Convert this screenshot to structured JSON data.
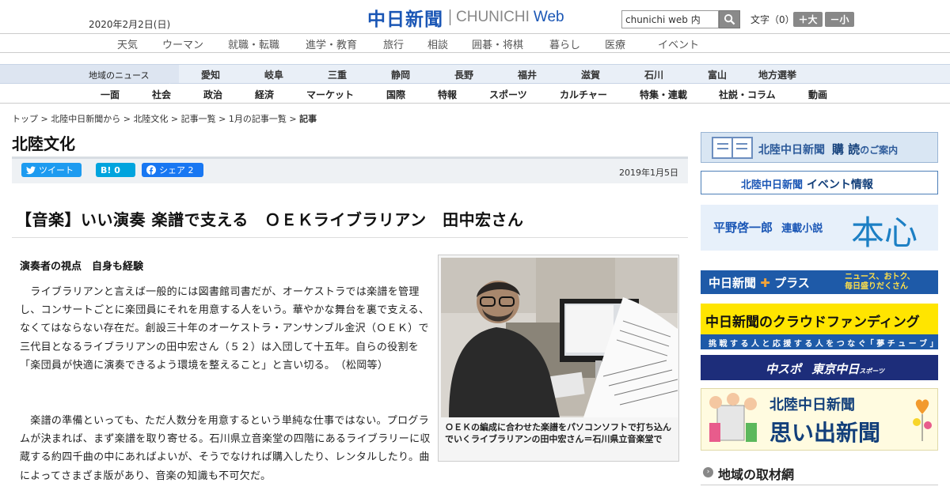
{
  "header": {
    "date": "2020年2月2日(日)",
    "logo_jp": "中日新聞",
    "logo_en": "CHUNICHI",
    "logo_web": "Web",
    "search_placeholder": "chunichi web 内",
    "font_size_label": "文字（0）",
    "font_up": "＋大",
    "font_down": "－小"
  },
  "nav_top": [
    "天気",
    "ウーマン",
    "就職・転職",
    "進学・教育",
    "旅行",
    "相談",
    "囲碁・将棋",
    "暮らし",
    "医療",
    "イベント"
  ],
  "nav_region": {
    "label": "地域のニュース",
    "items": [
      "愛知",
      "岐阜",
      "三重",
      "静岡",
      "長野",
      "福井",
      "滋賀",
      "石川",
      "富山",
      "地方選挙"
    ]
  },
  "nav_sections": [
    "一面",
    "社会",
    "政治",
    "経済",
    "マーケット",
    "国際",
    "特報",
    "スポーツ",
    "カルチャー",
    "特集・連載",
    "社説・コラム",
    "動画"
  ],
  "breadcrumb": [
    "トップ",
    "北陸中日新聞から",
    "北陸文化",
    "記事一覧",
    "1月の記事一覧",
    "記事"
  ],
  "section_title": "北陸文化",
  "share": {
    "tweet": "ツイート",
    "hatena": "B! 0",
    "facebook": "シェア 2"
  },
  "pub_date": "2019年1月5日",
  "article": {
    "headline": "【音楽】いい演奏 楽譜で支える　ＯＥＫライブラリアン　田中宏さん",
    "subhead": "演奏者の視点　自身も経験",
    "paragraphs": [
      "　ライブラリアンと言えば一般的には図書館司書だが、オーケストラでは楽譜を管理し、コンサートごとに楽団員にそれを用意する人をいう。華やかな舞台を裏で支える、なくてはならない存在だ。創設三十年のオーケストラ・アンサンブル金沢（ＯＥＫ）で三代目となるライブラリアンの田中宏さん（５２）は入団して十五年。自らの役割を「楽団員が快適に演奏できるよう環境を整えること」と言い切る。　（松岡等）",
      "　楽譜の準備といっても、ただ人数分を用意するという単純な仕事ではない。プログラムが決まれば、まず楽譜を取り寄せる。石川県立音楽堂の四階にあるライブラリーに収蔵する約四千曲の中にあればよいが、そうでなければ購入したり、レンタルしたり。曲によってさまざま版があり、音楽の知識も不可欠だ。"
    ],
    "photo_caption": "ＯＥＫの編成に合わせた楽譜をパソコンソフトで打ち込んでいくライブラリアンの田中宏さん＝石川県立音楽堂で"
  },
  "sidebar": {
    "subscribe_main": "北陸中日新聞",
    "subscribe_sub": "購 読",
    "subscribe_tail": "のご案内",
    "events_a": "北陸中日新聞",
    "events_b": "イベント情報",
    "novel_author": "平野啓一郎",
    "novel_kind": "連載小説",
    "novel_title": "本心",
    "plus_name": "中日新聞",
    "plus_label": "プラス",
    "plus_tag1": "ニュース、おトク、",
    "plus_tag2": "毎日盛りだくさん",
    "cf_title": "中日新聞のクラウドファンディング",
    "cf_sub": "挑 戦 す る 人 と 応 援 す る 人 を つ な ぐ「 夢 チ ュ ー ブ 」",
    "chuspo": "中スポ",
    "tokyo": "東京中日",
    "tokyo_sub": "スポーツ",
    "memory_a": "北陸中日新聞",
    "memory_b": "思い出新聞",
    "region_links": "地域の取材網"
  },
  "colors": {
    "brand_blue": "#1a56b5",
    "twitter": "#1d9bf0",
    "hatena": "#00a4de",
    "facebook": "#1877f2",
    "cf_yellow": "#ffe500"
  }
}
